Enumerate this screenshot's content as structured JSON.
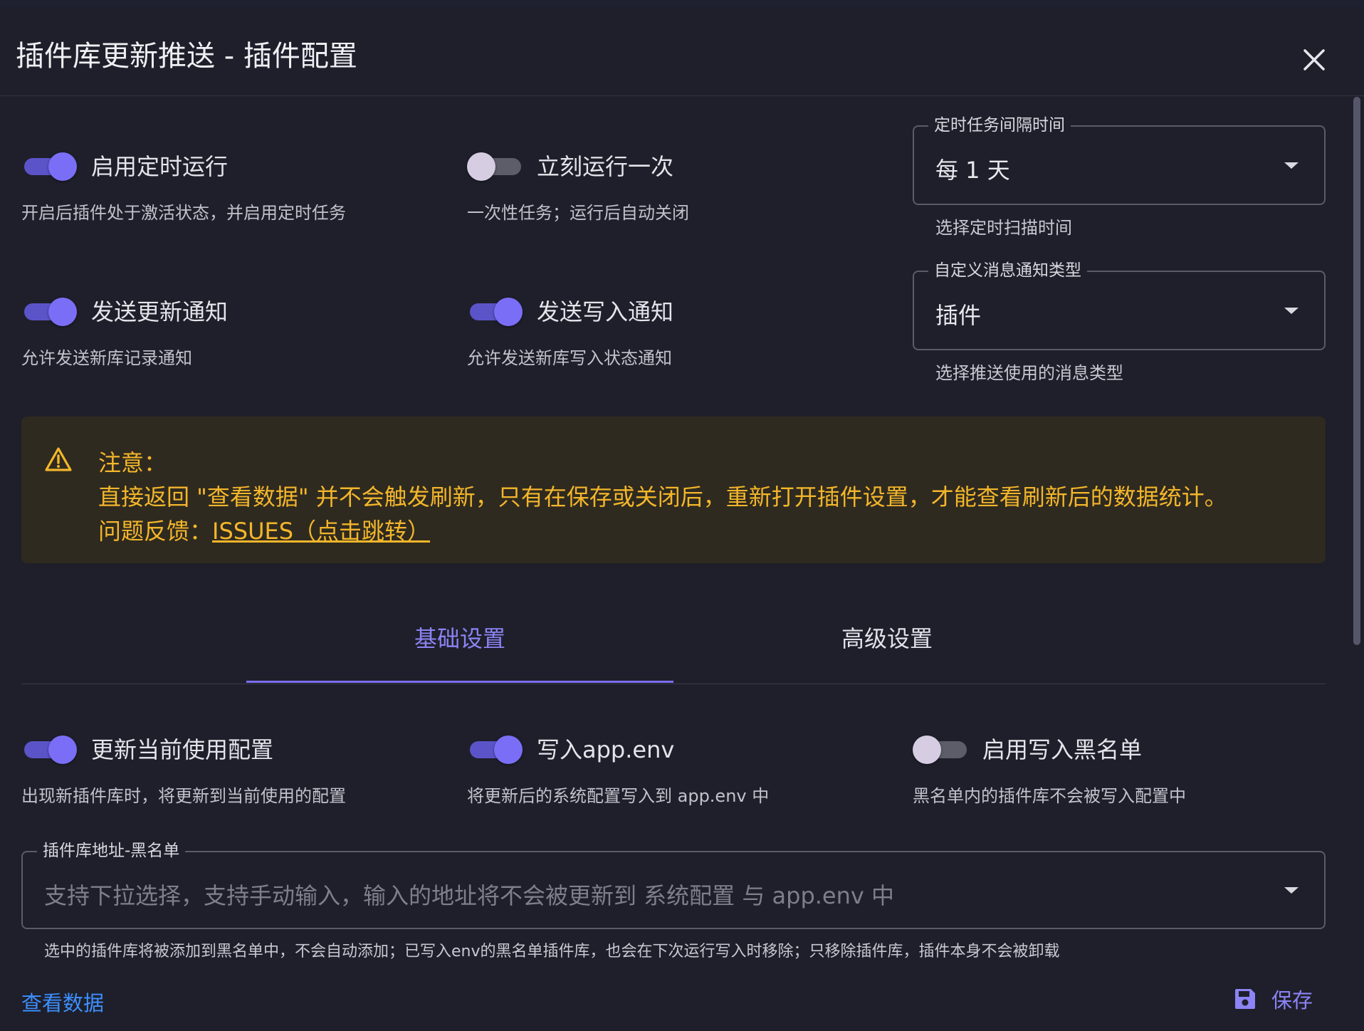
{
  "dialog": {
    "title": "插件库更新推送 - 插件配置"
  },
  "switches": {
    "enable_cron": {
      "label": "启用定时运行",
      "hint": "开启后插件处于激活状态，并启用定时任务",
      "on": true
    },
    "run_once": {
      "label": "立刻运行一次",
      "hint": "一次性任务；运行后自动关闭",
      "on": false
    },
    "send_update_notify": {
      "label": "发送更新通知",
      "hint": "允许发送新库记录通知",
      "on": true
    },
    "send_write_notify": {
      "label": "发送写入通知",
      "hint": "允许发送新库写入状态通知",
      "on": true
    },
    "update_current_config": {
      "label": "更新当前使用配置",
      "hint": "出现新插件库时，将更新到当前使用的配置",
      "on": true
    },
    "write_app_env": {
      "label": "写入app.env",
      "hint": "将更新后的系统配置写入到 app.env 中",
      "on": true
    },
    "enable_blacklist": {
      "label": "启用写入黑名单",
      "hint": "黑名单内的插件库不会被写入配置中",
      "on": false
    }
  },
  "selects": {
    "interval": {
      "label": "定时任务间隔时间",
      "value": "每 1 天",
      "hint": "选择定时扫描时间"
    },
    "msg_type": {
      "label": "自定义消息通知类型",
      "value": "插件",
      "hint": "选择推送使用的消息类型"
    }
  },
  "alert": {
    "title": "注意：",
    "text": "直接返回 \"查看数据\" 并不会触发刷新，只有在保存或关闭后，重新打开插件设置，才能查看刷新后的数据统计。",
    "feedback_prefix": "问题反馈：",
    "feedback_link": "ISSUES（点击跳转）"
  },
  "tabs": [
    {
      "label": "基础设置",
      "active": true
    },
    {
      "label": "高级设置",
      "active": false
    }
  ],
  "blacklist": {
    "label": "插件库地址-黑名单",
    "placeholder": "支持下拉选择，支持手动输入，输入的地址将不会被更新到 系统配置 与 app.env 中",
    "hint": "选中的插件库将被添加到黑名单中，不会自动添加；已写入env的黑名单插件库，也会在下次运行写入时移除；只移除插件库，插件本身不会被卸载"
  },
  "footer": {
    "view_data": "查看数据",
    "save": "保存"
  },
  "colors": {
    "accent": "#7b6ef6",
    "warning": "#f3b62b",
    "link": "#3d8fff",
    "background": "#1e1f2a"
  }
}
